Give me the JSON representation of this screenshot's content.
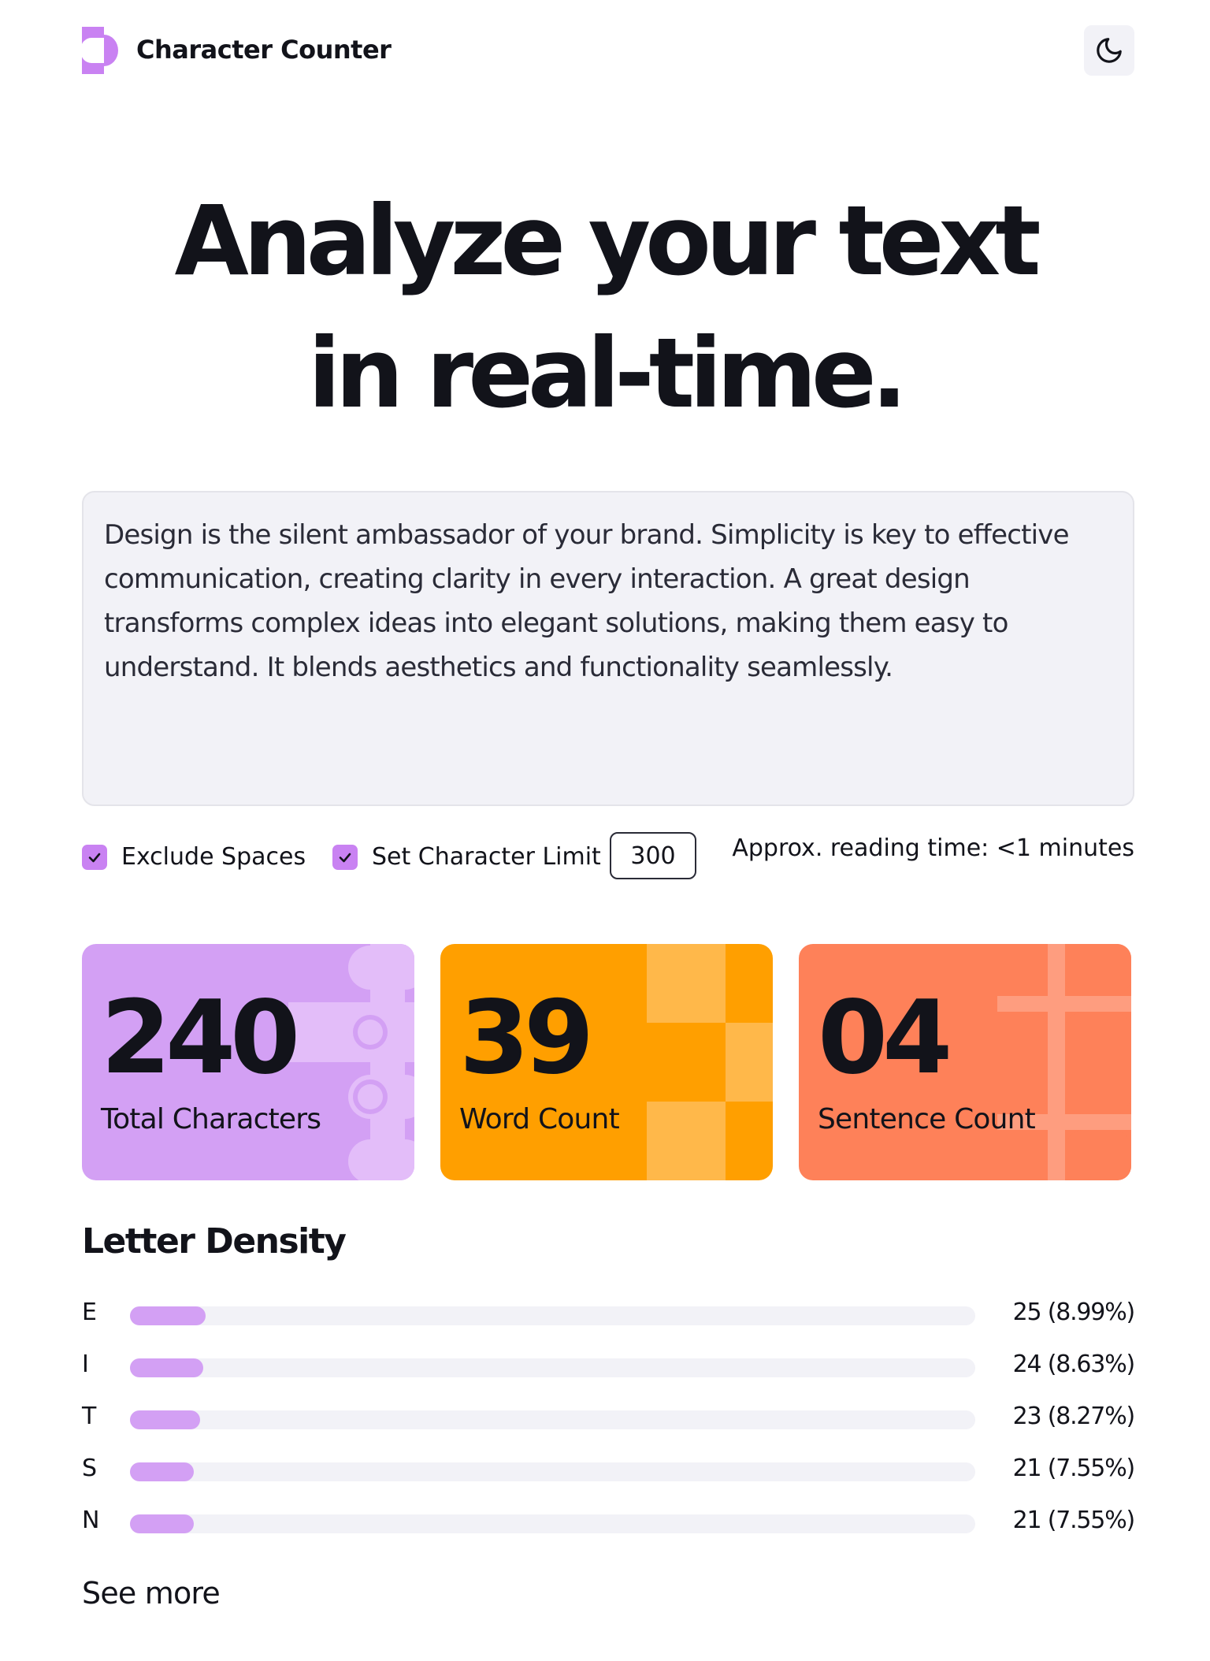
{
  "header": {
    "app_title": "Character Counter",
    "logo_icon": "half-circle-logo-icon",
    "theme_toggle_icon": "moon-icon"
  },
  "hero": {
    "line1": "Analyze your text",
    "line2": "in real-time."
  },
  "input": {
    "text": "Design is the silent ambassador of your brand. Simplicity is key to effective communication, creating clarity in every interaction. A great design transforms complex ideas into elegant solutions, making them easy to understand. It blends aesthetics and functionality seamlessly."
  },
  "options": {
    "exclude_spaces": {
      "label": "Exclude Spaces",
      "checked": true
    },
    "char_limit": {
      "label": "Set Character Limit",
      "checked": true,
      "value": "300"
    },
    "reading_time": "Approx. reading time: <1 minutes"
  },
  "stats": [
    {
      "value": "240",
      "label": "Total Characters",
      "color": "#d3a0f4"
    },
    {
      "value": "39",
      "label": "Word Count",
      "color": "#ff9f00"
    },
    {
      "value": "04",
      "label": "Sentence Count",
      "color": "#fe8159"
    }
  ],
  "density": {
    "title": "Letter Density",
    "rows": [
      {
        "letter": "E",
        "count": 25,
        "percent": 8.99,
        "stat": "25 (8.99%)"
      },
      {
        "letter": "I",
        "count": 24,
        "percent": 8.63,
        "stat": "24 (8.63%)"
      },
      {
        "letter": "T",
        "count": 23,
        "percent": 8.27,
        "stat": "23 (8.27%)"
      },
      {
        "letter": "S",
        "count": 21,
        "percent": 7.55,
        "stat": "21 (7.55%)"
      },
      {
        "letter": "N",
        "count": 21,
        "percent": 7.55,
        "stat": "21 (7.55%)"
      }
    ],
    "see_more": "See more"
  },
  "colors": {
    "accent_purple": "#c982f2",
    "bar_fill": "#d3a0f4",
    "track": "#f2f2f7",
    "text": "#12131a"
  }
}
